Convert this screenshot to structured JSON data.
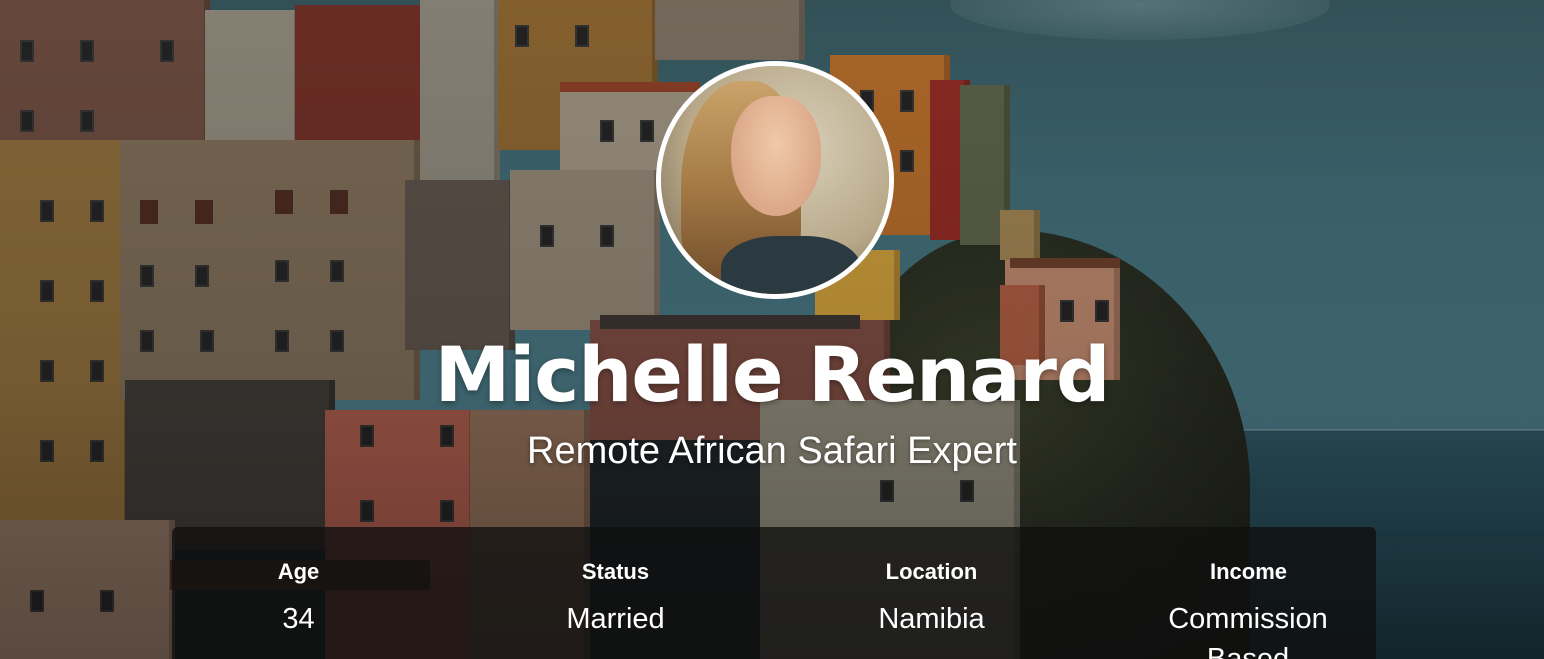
{
  "profile": {
    "name": "Michelle Renard",
    "title": "Remote African Safari Expert"
  },
  "stats": [
    {
      "label": "Age",
      "value": "34"
    },
    {
      "label": "Status",
      "value": "Married"
    },
    {
      "label": "Location",
      "value": "Namibia"
    },
    {
      "label": "Income",
      "value": "Commission Based"
    }
  ],
  "colors": {
    "text": "#ffffff",
    "stats_panel": "#0f0f0f",
    "avatar_border": "#ffffff"
  }
}
